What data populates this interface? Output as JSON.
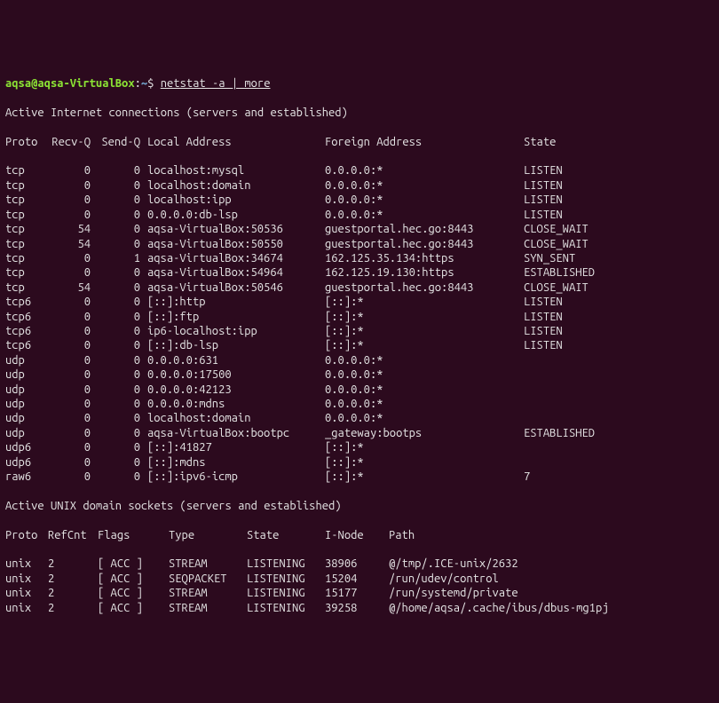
{
  "prompt": {
    "user": "aqsa",
    "host": "aqsa-VirtualBox",
    "path": "~",
    "symbol": "$",
    "command": "netstat -a | more"
  },
  "sections": {
    "inet_header": "Active Internet connections (servers and established)",
    "unix_header": "Active UNIX domain sockets (servers and established)"
  },
  "inet_columns": {
    "proto": "Proto",
    "recvq": "Recv-Q",
    "sendq": "Send-Q",
    "local": "Local Address",
    "foreign": "Foreign Address",
    "state": "State"
  },
  "inet_rows": [
    {
      "proto": "tcp",
      "recvq": "0",
      "sendq": "0",
      "local": "localhost:mysql",
      "foreign": "0.0.0.0:*",
      "state": "LISTEN"
    },
    {
      "proto": "tcp",
      "recvq": "0",
      "sendq": "0",
      "local": "localhost:domain",
      "foreign": "0.0.0.0:*",
      "state": "LISTEN"
    },
    {
      "proto": "tcp",
      "recvq": "0",
      "sendq": "0",
      "local": "localhost:ipp",
      "foreign": "0.0.0.0:*",
      "state": "LISTEN"
    },
    {
      "proto": "tcp",
      "recvq": "0",
      "sendq": "0",
      "local": "0.0.0.0:db-lsp",
      "foreign": "0.0.0.0:*",
      "state": "LISTEN"
    },
    {
      "proto": "tcp",
      "recvq": "54",
      "sendq": "0",
      "local": "aqsa-VirtualBox:50536",
      "foreign": "guestportal.hec.go:8443",
      "state": "CLOSE_WAIT"
    },
    {
      "proto": "tcp",
      "recvq": "54",
      "sendq": "0",
      "local": "aqsa-VirtualBox:50550",
      "foreign": "guestportal.hec.go:8443",
      "state": "CLOSE_WAIT"
    },
    {
      "proto": "tcp",
      "recvq": "0",
      "sendq": "1",
      "local": "aqsa-VirtualBox:34674",
      "foreign": "162.125.35.134:https",
      "state": "SYN_SENT"
    },
    {
      "proto": "tcp",
      "recvq": "0",
      "sendq": "0",
      "local": "aqsa-VirtualBox:54964",
      "foreign": "162.125.19.130:https",
      "state": "ESTABLISHED"
    },
    {
      "proto": "tcp",
      "recvq": "54",
      "sendq": "0",
      "local": "aqsa-VirtualBox:50546",
      "foreign": "guestportal.hec.go:8443",
      "state": "CLOSE_WAIT"
    },
    {
      "proto": "tcp6",
      "recvq": "0",
      "sendq": "0",
      "local": "[::]:http",
      "foreign": "[::]:*",
      "state": "LISTEN"
    },
    {
      "proto": "tcp6",
      "recvq": "0",
      "sendq": "0",
      "local": "[::]:ftp",
      "foreign": "[::]:*",
      "state": "LISTEN"
    },
    {
      "proto": "tcp6",
      "recvq": "0",
      "sendq": "0",
      "local": "ip6-localhost:ipp",
      "foreign": "[::]:*",
      "state": "LISTEN"
    },
    {
      "proto": "tcp6",
      "recvq": "0",
      "sendq": "0",
      "local": "[::]:db-lsp",
      "foreign": "[::]:*",
      "state": "LISTEN"
    },
    {
      "proto": "udp",
      "recvq": "0",
      "sendq": "0",
      "local": "0.0.0.0:631",
      "foreign": "0.0.0.0:*",
      "state": ""
    },
    {
      "proto": "udp",
      "recvq": "0",
      "sendq": "0",
      "local": "0.0.0.0:17500",
      "foreign": "0.0.0.0:*",
      "state": ""
    },
    {
      "proto": "udp",
      "recvq": "0",
      "sendq": "0",
      "local": "0.0.0.0:42123",
      "foreign": "0.0.0.0:*",
      "state": ""
    },
    {
      "proto": "udp",
      "recvq": "0",
      "sendq": "0",
      "local": "0.0.0.0:mdns",
      "foreign": "0.0.0.0:*",
      "state": ""
    },
    {
      "proto": "udp",
      "recvq": "0",
      "sendq": "0",
      "local": "localhost:domain",
      "foreign": "0.0.0.0:*",
      "state": ""
    },
    {
      "proto": "udp",
      "recvq": "0",
      "sendq": "0",
      "local": "aqsa-VirtualBox:bootpc",
      "foreign": "_gateway:bootps",
      "state": "ESTABLISHED"
    },
    {
      "proto": "udp6",
      "recvq": "0",
      "sendq": "0",
      "local": "[::]:41827",
      "foreign": "[::]:*",
      "state": ""
    },
    {
      "proto": "udp6",
      "recvq": "0",
      "sendq": "0",
      "local": "[::]:mdns",
      "foreign": "[::]:*",
      "state": ""
    },
    {
      "proto": "raw6",
      "recvq": "0",
      "sendq": "0",
      "local": "[::]:ipv6-icmp",
      "foreign": "[::]:*",
      "state": "7"
    }
  ],
  "unix_columns": {
    "proto": "Proto",
    "refcnt": "RefCnt",
    "flags": "Flags",
    "type": "Type",
    "state": "State",
    "inode": "I-Node",
    "path": "Path"
  },
  "unix_rows": [
    {
      "proto": "unix",
      "refcnt": "2",
      "flags": "[ ACC ]",
      "type": "STREAM",
      "state": "LISTENING",
      "inode": "38906",
      "path": "@/tmp/.ICE-unix/2632"
    },
    {
      "proto": "unix",
      "refcnt": "2",
      "flags": "[ ACC ]",
      "type": "SEQPACKET",
      "state": "LISTENING",
      "inode": "15204",
      "path": "/run/udev/control"
    },
    {
      "proto": "unix",
      "refcnt": "2",
      "flags": "[ ACC ]",
      "type": "STREAM",
      "state": "LISTENING",
      "inode": "15177",
      "path": "/run/systemd/private"
    },
    {
      "proto": "unix",
      "refcnt": "2",
      "flags": "[ ACC ]",
      "type": "STREAM",
      "state": "LISTENING",
      "inode": "39258",
      "path": "@/home/aqsa/.cache/ibus/dbus-mg1pj"
    }
  ]
}
